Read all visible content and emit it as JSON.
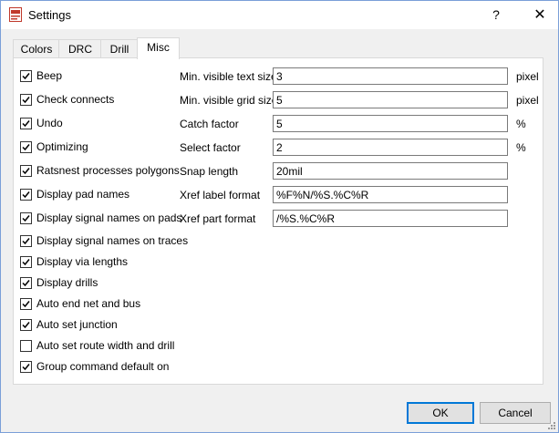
{
  "window": {
    "title": "Settings",
    "help": "?",
    "close": "✕"
  },
  "tabs": [
    {
      "label": "Colors",
      "active": false
    },
    {
      "label": "DRC",
      "active": false
    },
    {
      "label": "Drill",
      "active": false
    },
    {
      "label": "Misc",
      "active": true
    }
  ],
  "checkboxes": [
    {
      "label": "Beep",
      "checked": true
    },
    {
      "label": "Check connects",
      "checked": true
    },
    {
      "label": "Undo",
      "checked": true
    },
    {
      "label": "Optimizing",
      "checked": true
    },
    {
      "label": "Ratsnest processes polygons",
      "checked": true
    },
    {
      "label": "Display pad names",
      "checked": true
    },
    {
      "label": "Display signal names on pads",
      "checked": true
    },
    {
      "label": "Display signal names on traces",
      "checked": true
    },
    {
      "label": "Display via lengths",
      "checked": true
    },
    {
      "label": "Display drills",
      "checked": true
    },
    {
      "label": "Auto end net and bus",
      "checked": true
    },
    {
      "label": "Auto set junction",
      "checked": true
    },
    {
      "label": "Auto set route width and drill",
      "checked": false
    },
    {
      "label": "Group command default on",
      "checked": true
    }
  ],
  "fields": [
    {
      "label": "Min. visible text size",
      "value": "3",
      "unit": "pixel"
    },
    {
      "label": "Min. visible grid size",
      "value": "5",
      "unit": "pixel"
    },
    {
      "label": "Catch factor",
      "value": "5",
      "unit": "%"
    },
    {
      "label": "Select factor",
      "value": "2",
      "unit": "%"
    },
    {
      "label": "Snap length",
      "value": "20mil",
      "unit": ""
    },
    {
      "label": "Xref label format",
      "value": "%F%N/%S.%C%R",
      "unit": ""
    },
    {
      "label": "Xref part format",
      "value": "/%S.%C%R",
      "unit": ""
    }
  ],
  "buttons": {
    "ok": "OK",
    "cancel": "Cancel"
  }
}
